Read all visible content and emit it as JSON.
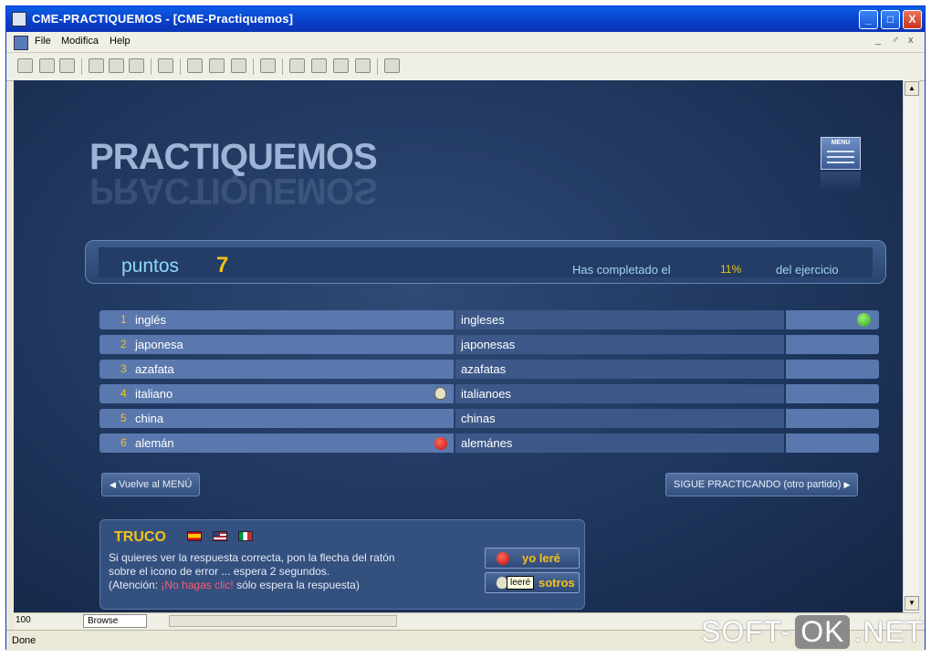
{
  "window": {
    "title": "CME-PRACTIQUEMOS - [CME-Practiquemos]",
    "controls": [
      "_",
      "□",
      "X"
    ]
  },
  "menubar": {
    "items": [
      "File",
      "Modifica",
      "Help"
    ],
    "mdi_controls": [
      "_",
      "♂",
      "x"
    ]
  },
  "page": {
    "title": "PRACTIQUEMOS",
    "menu_icon_label": "MENU",
    "score_label": "puntos",
    "score_value": "7",
    "progress_prefix": "Has completado el",
    "progress_value": "11%",
    "progress_suffix": "del ejercicio"
  },
  "exercise_rows": [
    {
      "num": "1",
      "word": "inglés",
      "answer": "ingleses",
      "status": "correct"
    },
    {
      "num": "2",
      "word": "japonesa",
      "answer": "japonesas",
      "status": "none"
    },
    {
      "num": "3",
      "word": "azafata",
      "answer": "azafatas",
      "status": "none"
    },
    {
      "num": "4",
      "word": "italiano",
      "answer": "italianoes",
      "status": "skull"
    },
    {
      "num": "5",
      "word": "china",
      "answer": "chinas",
      "status": "none"
    },
    {
      "num": "6",
      "word": "alemán",
      "answer": "alemánes",
      "status": "error"
    }
  ],
  "nav": {
    "back_label": "Vuelve al MENÚ",
    "next_label": "SIGUE PRACTICANDO (otro partido)"
  },
  "truco": {
    "title": "TRUCO",
    "text_line1": "Si quieres ver la respuesta correcta, pon la flecha del ratón",
    "text_line2": "sobre el icono de error ... espera 2 segundos.",
    "text_line3_prefix": "(Atención: ",
    "text_line3_warn": "¡No hagas clic!",
    "text_line3_suffix": " sólo espera la respuesta)",
    "example1_label": "yo  leré",
    "example2_label": "sotros",
    "tooltip": "leeré"
  },
  "bottom_bar": {
    "zoom": "100",
    "browse_label": "Browse"
  },
  "status": {
    "text": "Done"
  },
  "watermark": {
    "part1": "SOFT-",
    "part2": "OK",
    "part3": ".NET"
  },
  "colors": {
    "accent_yellow": "#f2c21b",
    "title_blue": "#9eb3d6",
    "score_blue": "#8fd8ff",
    "warn_red": "#ff5a6e",
    "background": "#1f365d"
  }
}
